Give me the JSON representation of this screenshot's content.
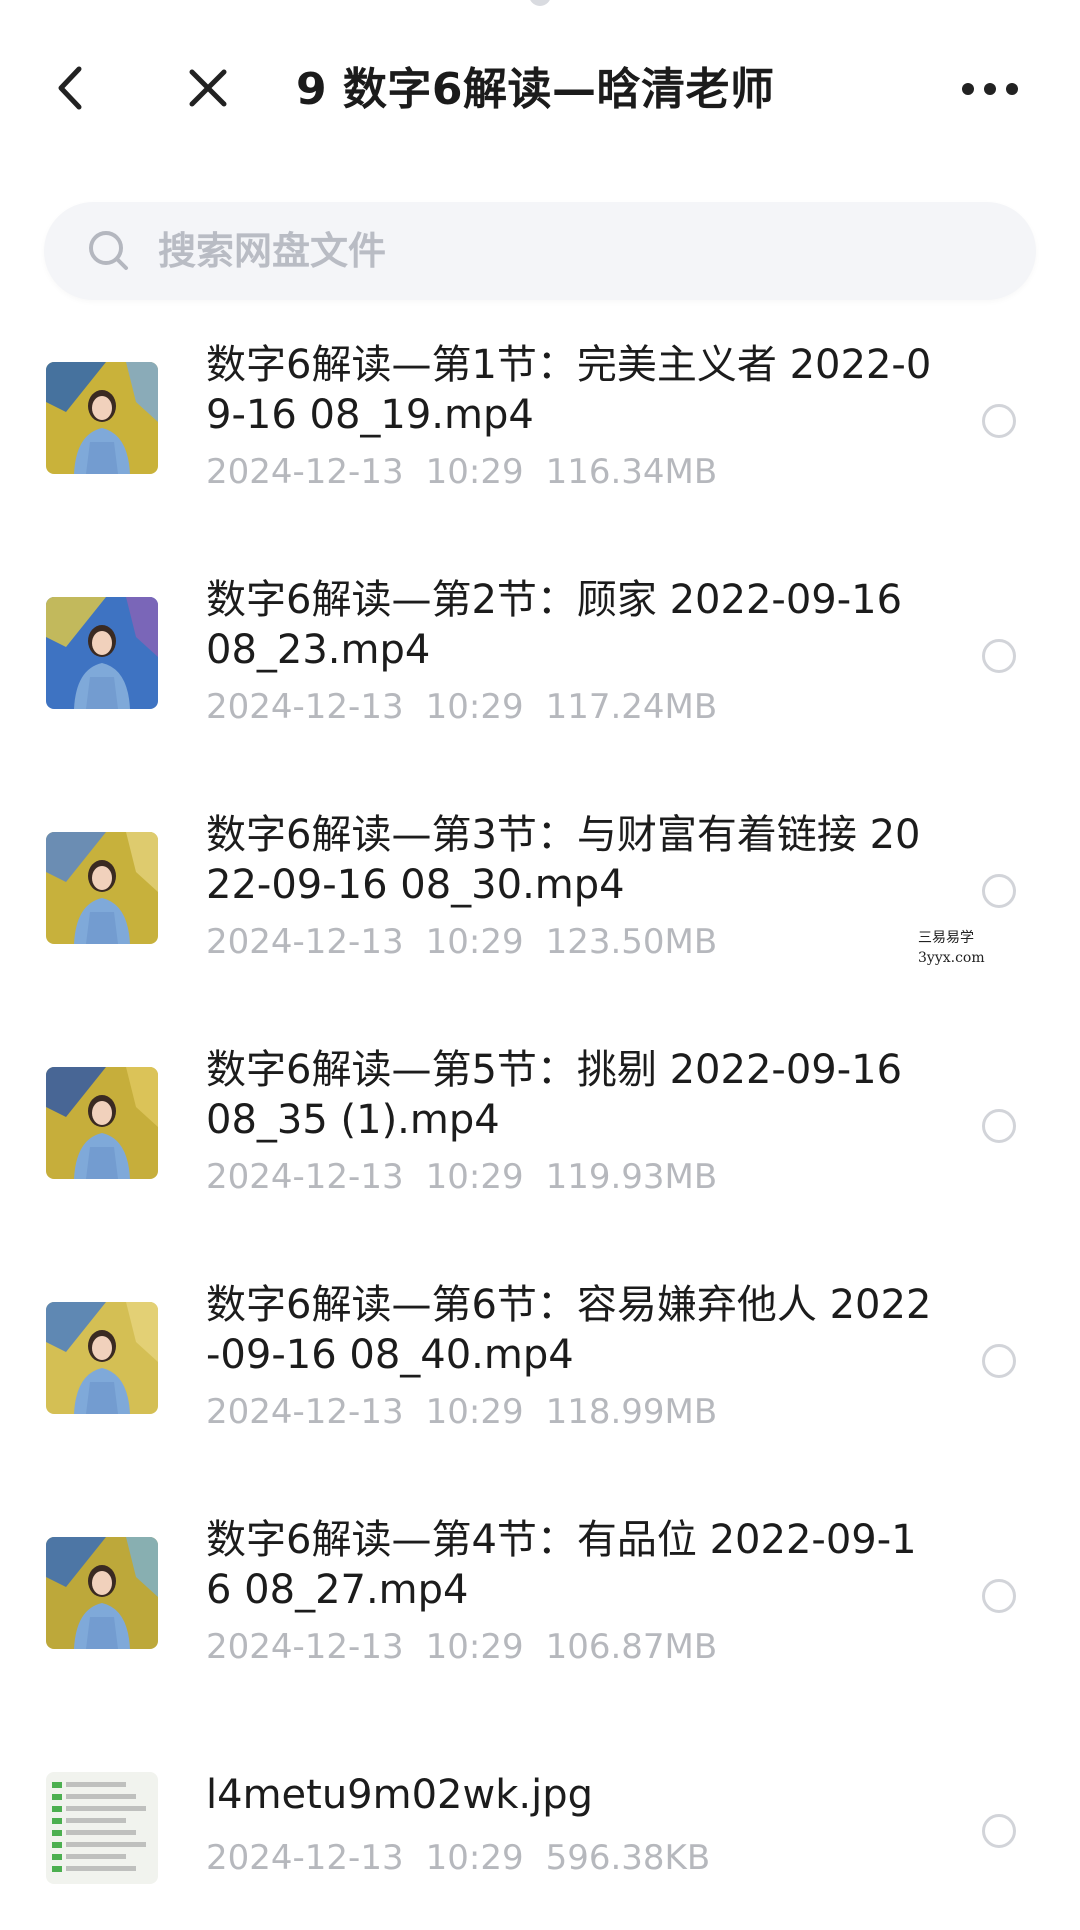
{
  "header": {
    "title": "9 数字6解读—晗清老师",
    "back_icon": "chevron-left-icon",
    "close_icon": "close-icon",
    "more_icon": "more-horizontal-icon"
  },
  "search": {
    "placeholder": "搜索网盘文件",
    "value": ""
  },
  "files": [
    {
      "name": "数字6解读—第1节：完美主义者 2022-09-16 08_19.mp4",
      "date": "2024-12-13",
      "time": "10:29",
      "size": "116.34MB",
      "type": "video",
      "thumb_colors": [
        "#c9b23a",
        "#2f66b0",
        "#7aa9d8"
      ]
    },
    {
      "name": "数字6解读—第2节：顾家 2022-09-16 08_23.mp4",
      "date": "2024-12-13",
      "time": "10:29",
      "size": "117.24MB",
      "type": "video",
      "thumb_colors": [
        "#3e73c2",
        "#d9c54a",
        "#8a63b5"
      ]
    },
    {
      "name": "数字6解读—第3节：与财富有着链接 2022-09-16 08_30.mp4",
      "date": "2024-12-13",
      "time": "10:29",
      "size": "123.50MB",
      "type": "video",
      "thumb_colors": [
        "#c7b13c",
        "#5a87c8",
        "#e3d27a"
      ]
    },
    {
      "name": "数字6解读—第5节：挑剔 2022-09-16 08_35 (1).mp4",
      "date": "2024-12-13",
      "time": "10:29",
      "size": "119.93MB",
      "type": "video",
      "thumb_colors": [
        "#c6ae3b",
        "#3159a6",
        "#e0c860"
      ]
    },
    {
      "name": "数字6解读—第6节：容易嫌弃他人 2022-09-16 08_40.mp4",
      "date": "2024-12-13",
      "time": "10:29",
      "size": "118.99MB",
      "type": "video",
      "thumb_colors": [
        "#d4bf54",
        "#4a7ec4",
        "#e6d47d"
      ]
    },
    {
      "name": "数字6解读—第4节：有品位 2022-09-16 08_27.mp4",
      "date": "2024-12-13",
      "time": "10:29",
      "size": "106.87MB",
      "type": "video",
      "thumb_colors": [
        "#bda83a",
        "#3a6db9",
        "#7ab0cf"
      ]
    },
    {
      "name": "l4metu9m02wk.jpg",
      "date": "2024-12-13",
      "time": "10:29",
      "size": "596.38KB",
      "type": "image",
      "thumb_colors": [
        "#f1f3ee",
        "#4caf50",
        "#9e9e9e"
      ]
    }
  ],
  "watermark": {
    "line1": "三易易学",
    "line2": "3yyx.com"
  }
}
